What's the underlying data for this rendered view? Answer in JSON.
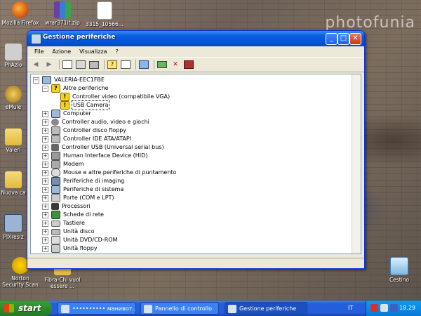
{
  "desktop": {
    "watermark": "photofunia",
    "icons": [
      {
        "label": "Mozilla Firefox"
      },
      {
        "label": "wrar371it.zip"
      },
      {
        "label": "3315_10566..."
      },
      {
        "label": "PhAzio"
      },
      {
        "label": "eMule"
      },
      {
        "label": "Valeri"
      },
      {
        "label": "Nuova ca"
      },
      {
        "label": "PIXresiz"
      },
      {
        "label": "Norton Security Scan"
      },
      {
        "label": "Fibra-Chi vuol essere ..."
      },
      {
        "label": "Cestino"
      }
    ]
  },
  "window": {
    "title": "Gestione periferiche",
    "menu": [
      "File",
      "Azione",
      "Visualizza",
      "?"
    ],
    "tree": {
      "root": "VALERIA-EEC1FBE",
      "items": [
        {
          "label": "Altre periferiche",
          "expanded": true,
          "children": [
            {
              "label": "Controller video (compatibile VGA)",
              "warning": true
            },
            {
              "label": "USB Camera",
              "warning": true,
              "selected": true
            }
          ]
        },
        {
          "label": "Computer"
        },
        {
          "label": "Controller audio, video e giochi"
        },
        {
          "label": "Controller disco floppy"
        },
        {
          "label": "Controller IDE ATA/ATAPI"
        },
        {
          "label": "Controller USB (Universal serial bus)"
        },
        {
          "label": "Human Interface Device (HID)"
        },
        {
          "label": "Modem"
        },
        {
          "label": "Mouse e altre periferiche di puntamento"
        },
        {
          "label": "Periferiche di imaging"
        },
        {
          "label": "Periferiche di sistema"
        },
        {
          "label": "Porte (COM e LPT)"
        },
        {
          "label": "Processori"
        },
        {
          "label": "Schede di rete"
        },
        {
          "label": "Tastiere"
        },
        {
          "label": "Unità disco"
        },
        {
          "label": "Unità DVD/CD-ROM"
        },
        {
          "label": "Unità floppy"
        }
      ]
    }
  },
  "taskbar": {
    "start_label": "start",
    "tasks": [
      {
        "label": "•••••••••• манивот..."
      },
      {
        "label": "Pannello di controllo"
      },
      {
        "label": "Gestione periferiche",
        "active": true
      }
    ],
    "language": "IT",
    "clock": "18.29"
  },
  "colors": {
    "titlebar": "#0453d9",
    "taskbar": "#245edb",
    "start_button": "#2e8b2e",
    "warning": "#f4d21a"
  }
}
